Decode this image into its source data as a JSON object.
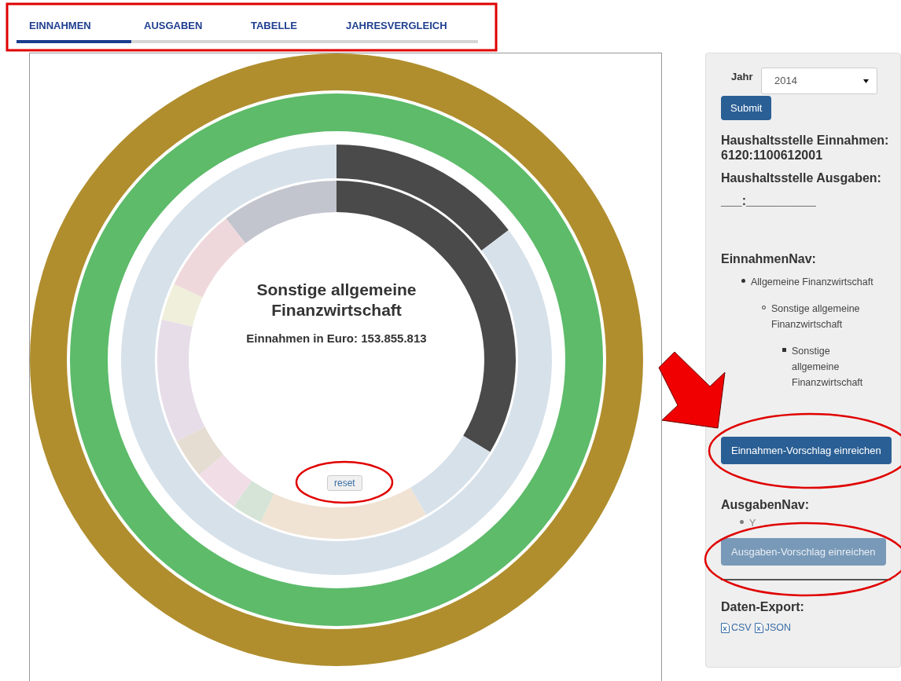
{
  "tabs": [
    {
      "label": "EINNAHMEN",
      "selected": true
    },
    {
      "label": "AUSGABEN",
      "selected": false
    },
    {
      "label": "TABELLE",
      "selected": false
    },
    {
      "label": "JAHRESVERGLEICH",
      "selected": false
    }
  ],
  "chart": {
    "title": "Sonstige allgemeine Finanzwirtschaft",
    "subtitle": "Einnahmen in Euro: 153.855.813",
    "reset_label": "reset"
  },
  "sidebar": {
    "year_label": "Jahr",
    "year_value": "2014",
    "submit_label": "Submit",
    "income_heading": "Haushaltsstelle Einnahmen:",
    "income_code": "6120:1100612001",
    "expense_heading": "Haushaltsstelle Ausgaben:",
    "expense_code": "___:__________",
    "income_nav_heading": "EinnahmenNav:",
    "income_nav": [
      {
        "label": "Allgemeine Finanzwirtschaft",
        "children": [
          {
            "label": "Sonstige allgemeine Finanzwirtschaft",
            "children": [
              {
                "label": "Sonstige allgemeine Finanzwirtschaft"
              }
            ]
          }
        ]
      }
    ],
    "income_button": {
      "label": "Einnahmen-Vorschlag einreichen",
      "disabled": false
    },
    "expense_nav_heading": "AusgabenNav:",
    "expense_nav": [
      {
        "label": "Y"
      }
    ],
    "expense_button": {
      "label": "Ausgaben-Vorschlag einreichen",
      "disabled": true
    },
    "export_heading": "Daten-Export:",
    "export_links": [
      "CSV",
      "JSON"
    ]
  }
}
